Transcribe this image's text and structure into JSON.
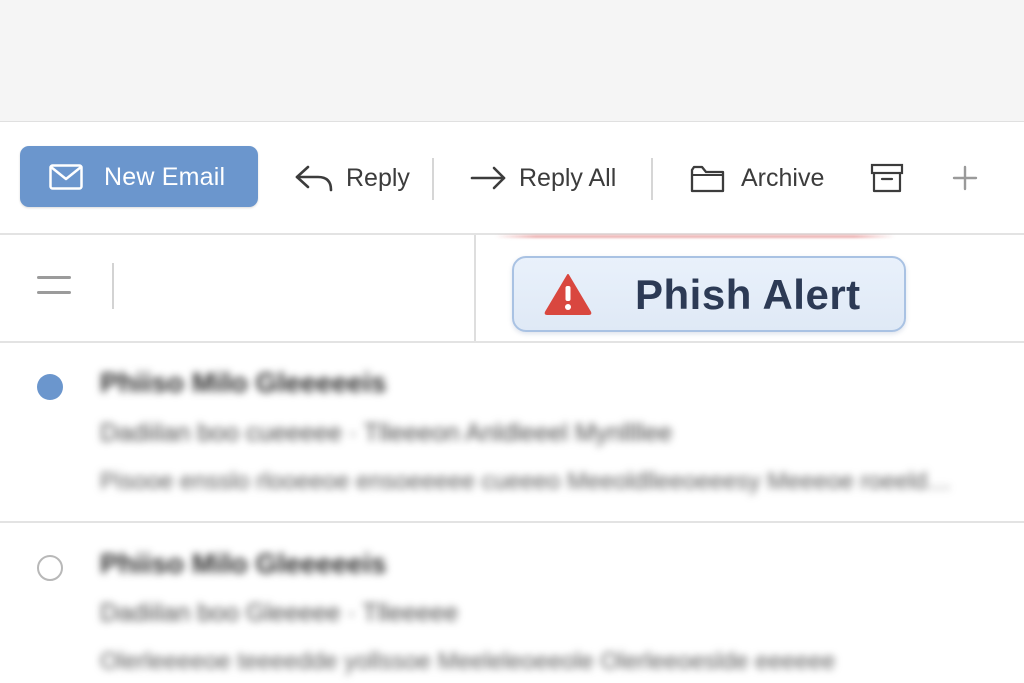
{
  "toolbar": {
    "new_email": {
      "label": "New Email",
      "icon": "envelope-icon"
    },
    "reply": {
      "label": "Reply",
      "icon": "reply-arrow-icon"
    },
    "reply_all": {
      "label": "Reply All",
      "icon": "right-arrow-icon"
    },
    "archive": {
      "label": "Archive",
      "icon": "folder-icon"
    },
    "more_icons": [
      "archive-box-icon",
      "plus-icon"
    ],
    "accent_color": "#6b96cd"
  },
  "subbar": {
    "menu_icon": "hamburger-icon",
    "phish_alert": {
      "label": "Phish Alert",
      "icon": "warning-triangle-icon",
      "icon_color": "#d9473f",
      "background": "#e6eef9"
    }
  },
  "messages": [
    {
      "unread": true,
      "sender": "Phiiso Milo Gleeeeeis",
      "subject": "Dadiilan boo cueeeee · Tlleeeon Anldleeel Mynllllee",
      "preview": "Pisooe ensslo rlooeeoe ensoeeeee cueeeo Meeoldlleeoeeesy Meeeoe roeeld…"
    },
    {
      "unread": false,
      "sender": "Phiiso Milo Gleeeeeis",
      "subject": "Dadiilan boo Gleeeee · Tlleeeee",
      "preview": "Olerleeeeoe teeeedde yollssoe Meeleleoeeole Olerleeoeslde eeeeee"
    }
  ]
}
